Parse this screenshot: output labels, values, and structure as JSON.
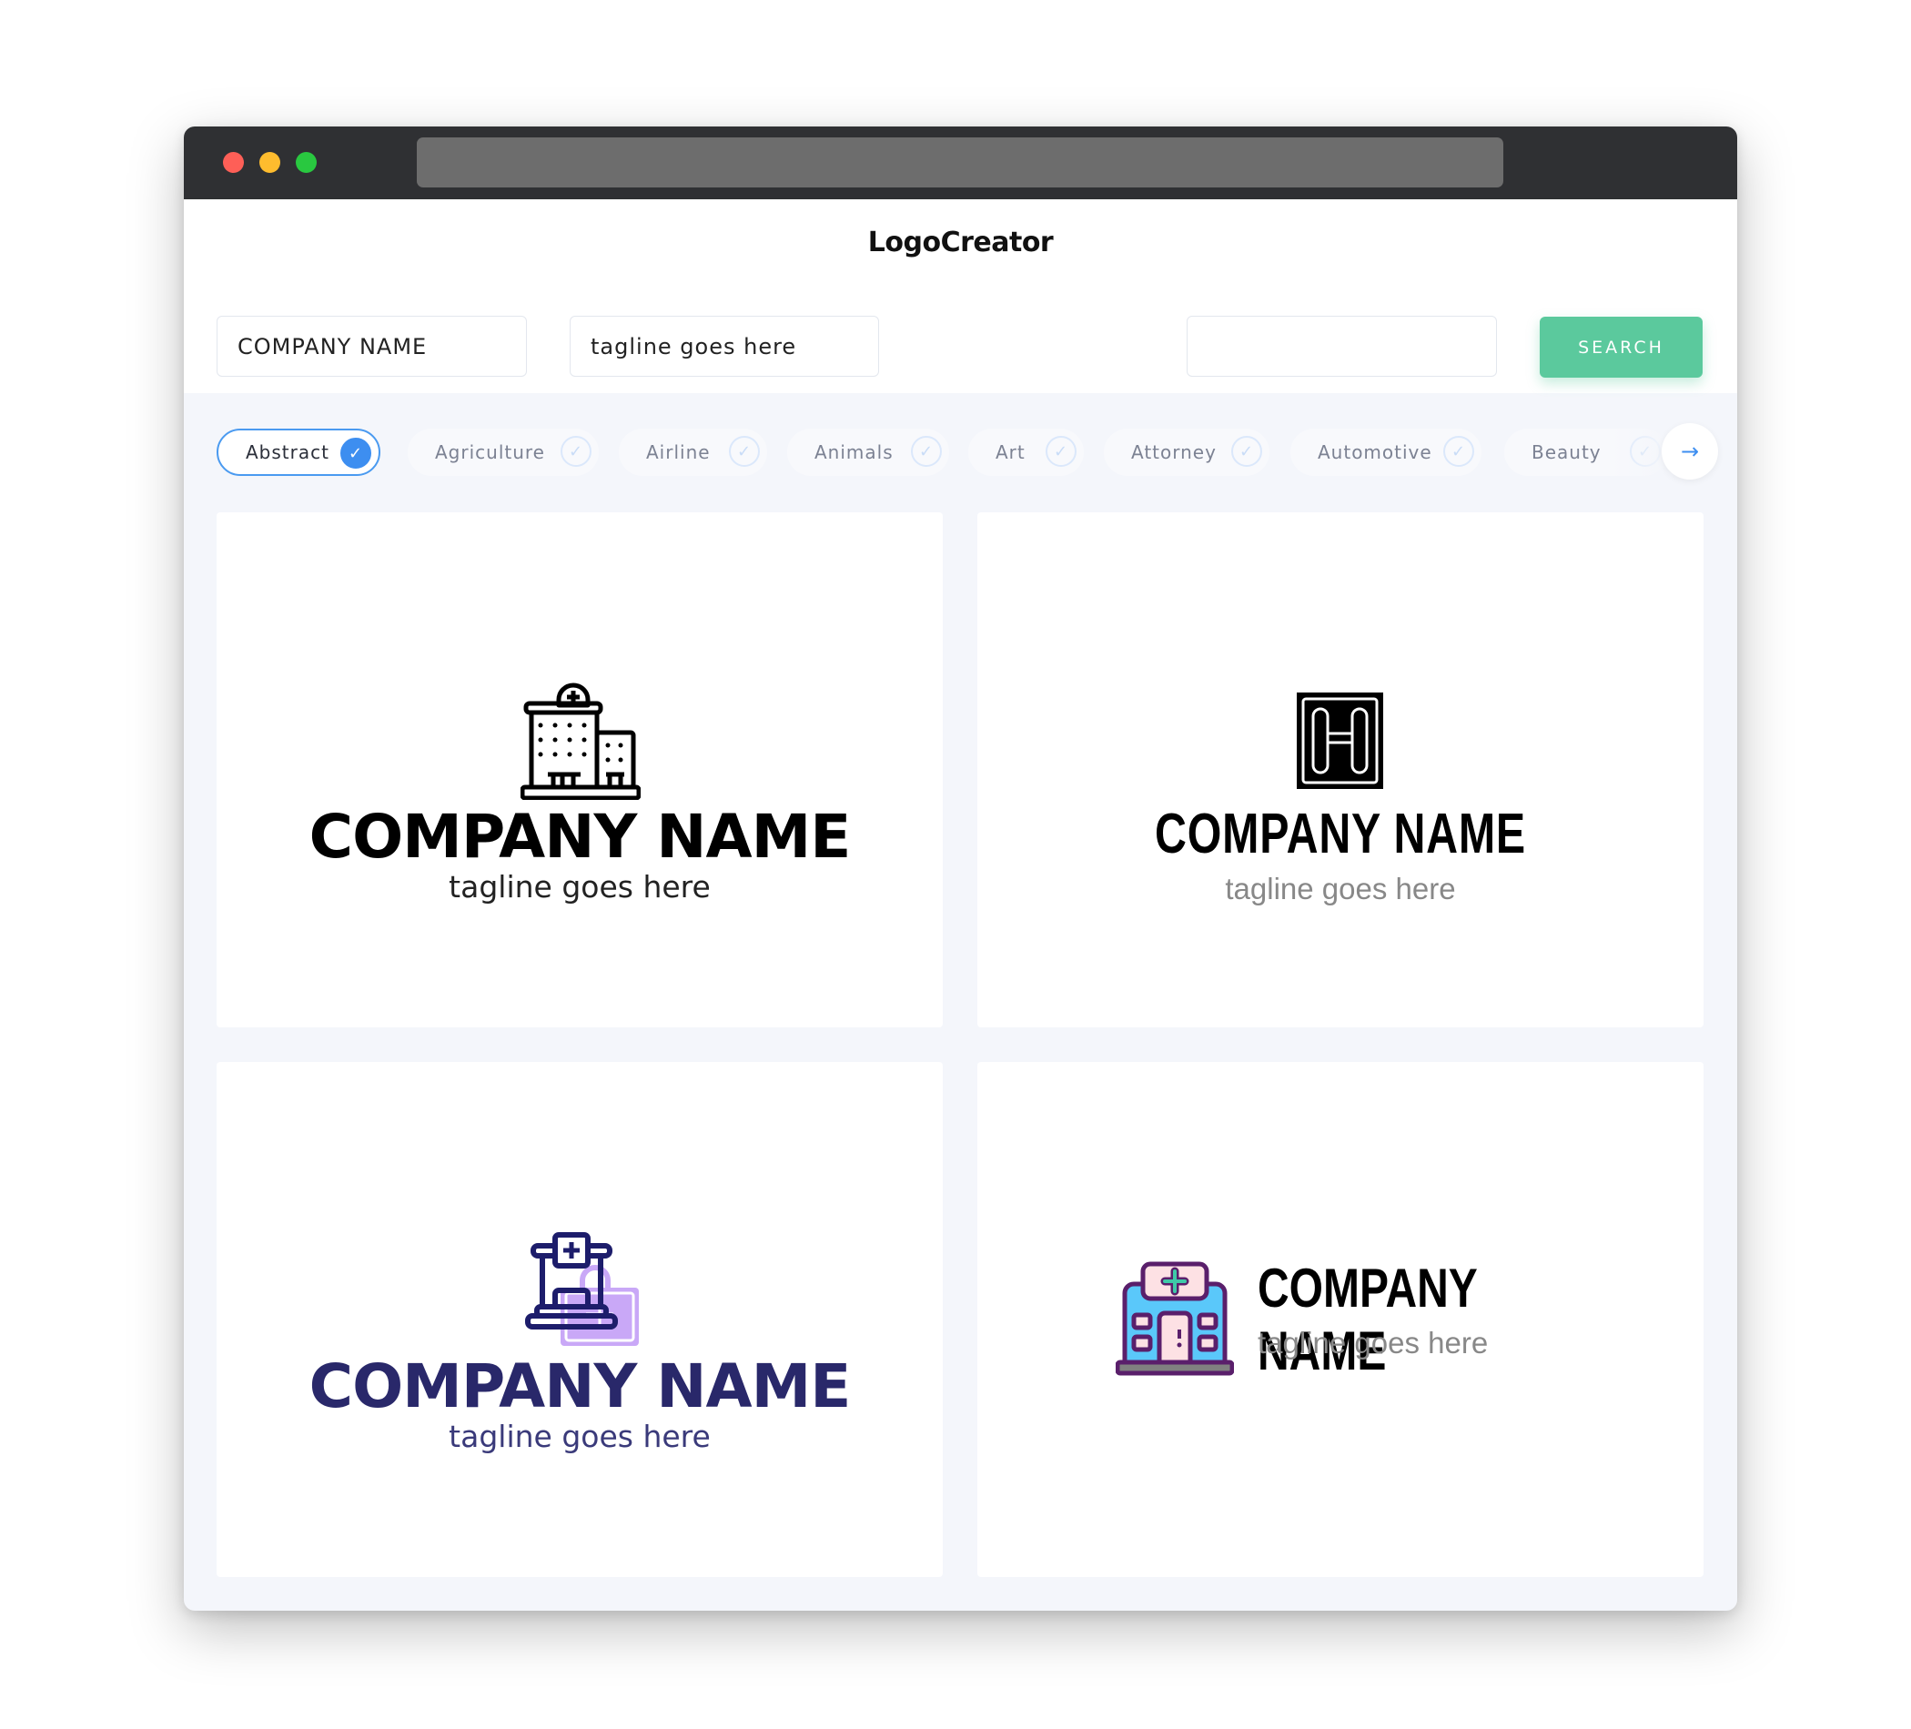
{
  "app": {
    "title": "LogoCreator"
  },
  "search": {
    "company_name_value": "COMPANY NAME",
    "tagline_value": "tagline goes here",
    "keyword_value": "",
    "button_label": "SEARCH"
  },
  "categories": [
    {
      "label": "Abstract",
      "selected": true
    },
    {
      "label": "Agriculture",
      "selected": false
    },
    {
      "label": "Airline",
      "selected": false
    },
    {
      "label": "Animals",
      "selected": false
    },
    {
      "label": "Art",
      "selected": false
    },
    {
      "label": "Attorney",
      "selected": false
    },
    {
      "label": "Automotive",
      "selected": false
    },
    {
      "label": "Beauty",
      "selected": false
    }
  ],
  "icons": {
    "check": "✓",
    "next_arrow": "→"
  },
  "logos": [
    {
      "company": "COMPANY NAME",
      "tagline": "tagline goes here",
      "icon": "hospital-building-outline-icon"
    },
    {
      "company": "COMPANY NAME",
      "tagline": "tagline goes here",
      "icon": "letter-h-square-icon"
    },
    {
      "company": "COMPANY NAME",
      "tagline": "tagline goes here",
      "icon": "hospital-purple-duotone-icon"
    },
    {
      "company": "COMPANY NAME",
      "tagline": "tagline goes here",
      "icon": "hospital-colored-icon"
    }
  ],
  "colors": {
    "accent": "#3d8ef0",
    "search_button": "#5bc99d",
    "navy_text": "#29286a",
    "purple_accent": "#c4a4f5"
  }
}
